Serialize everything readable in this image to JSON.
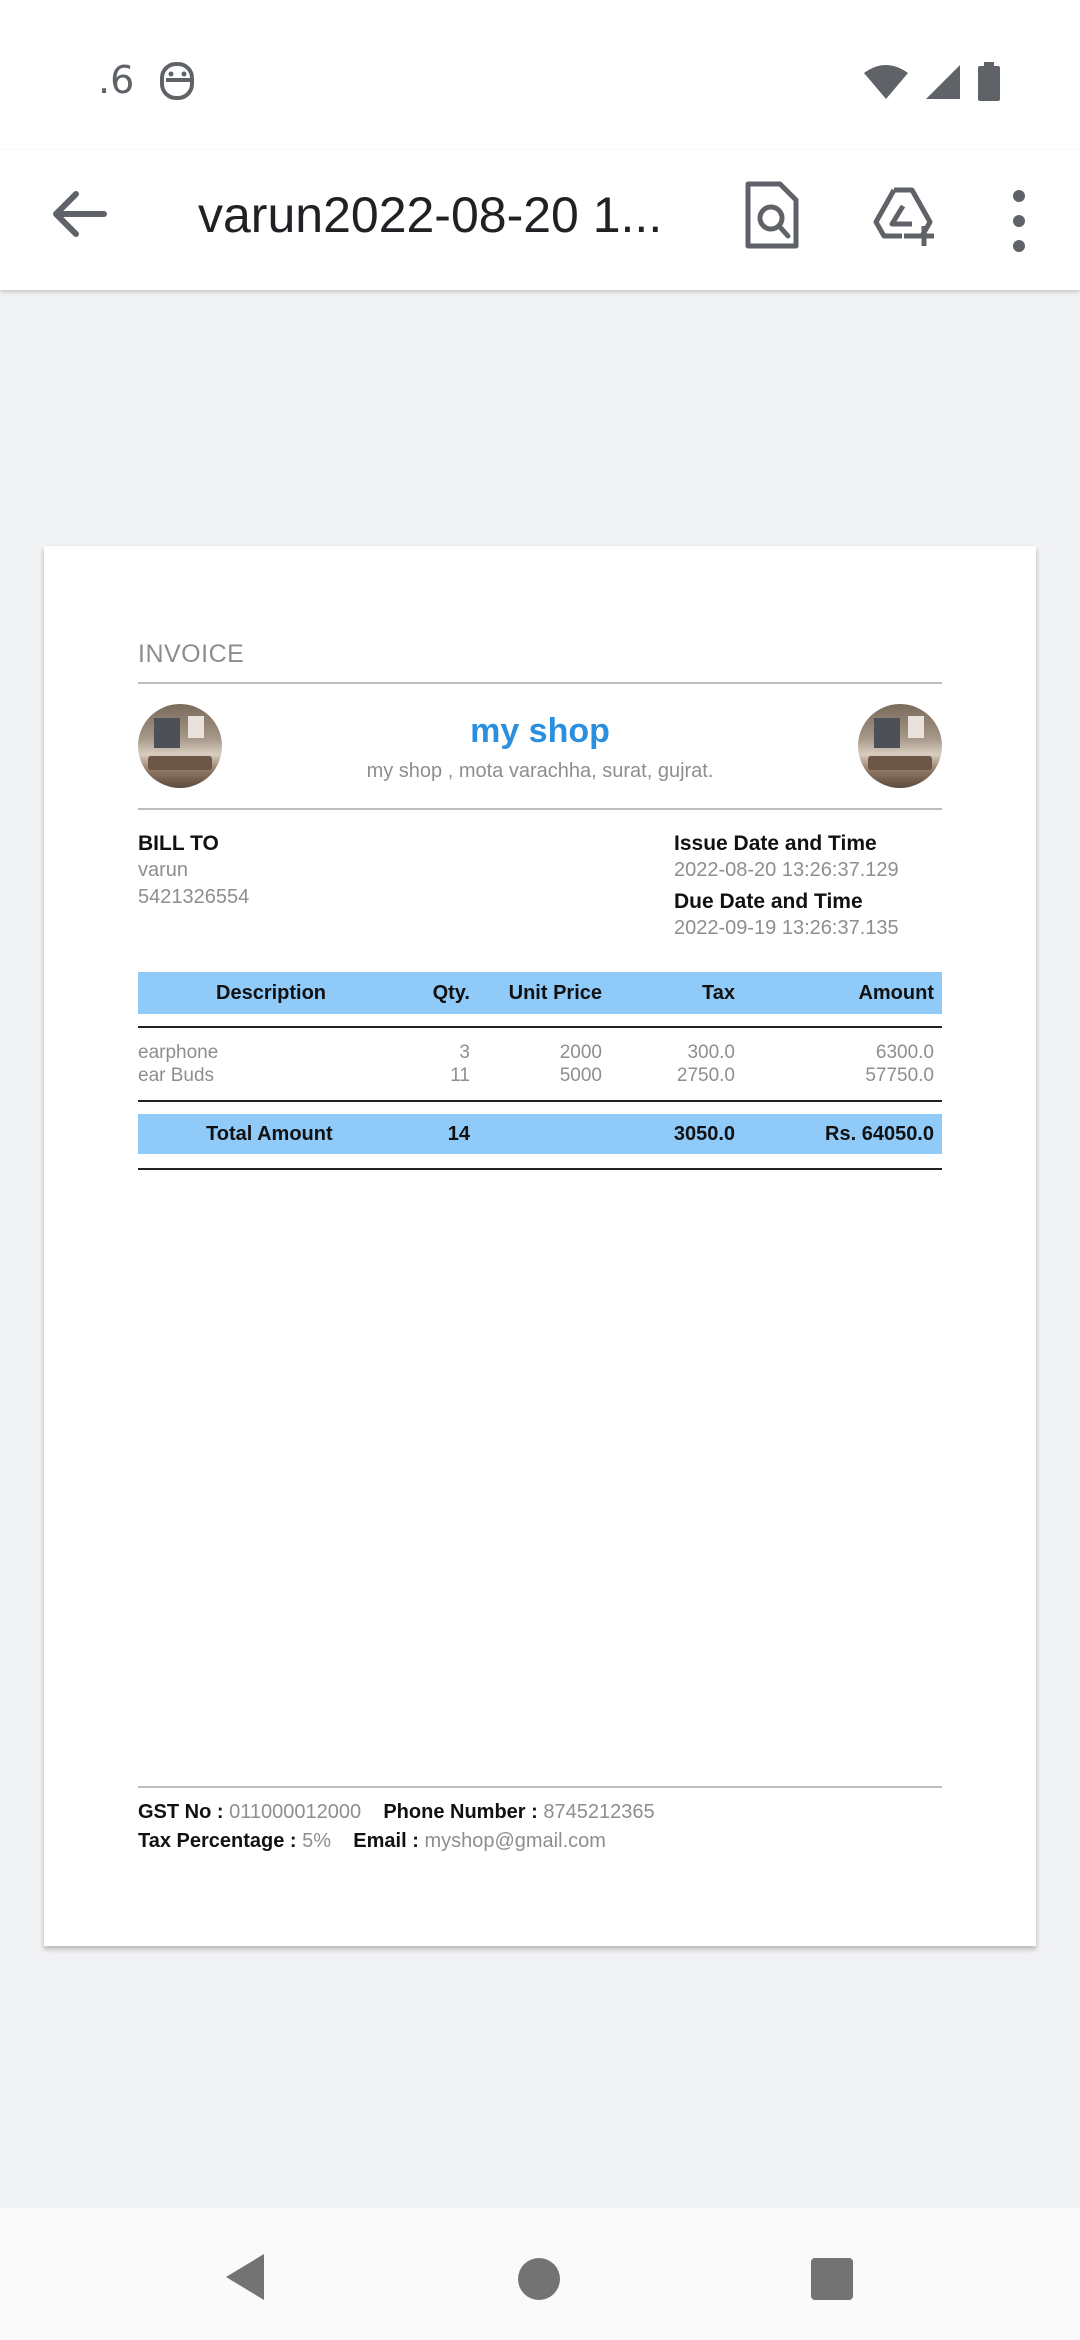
{
  "status_bar": {
    "time": ".6"
  },
  "app_bar": {
    "title": "varun2022-08-20 1..."
  },
  "invoice": {
    "heading": "INVOICE",
    "shop_name": "my shop",
    "shop_address": "my shop , mota varachha, surat, gujrat.",
    "bill_to_label": "BILL TO",
    "customer_name": "varun",
    "customer_phone": "5421326554",
    "issue_label": "Issue Date and Time",
    "issue_value": "2022-08-20 13:26:37.129",
    "due_label": "Due Date and Time",
    "due_value": "2022-09-19 13:26:37.135",
    "columns": [
      "Description",
      "Qty.",
      "Unit Price",
      "Tax",
      "Amount"
    ],
    "rows": [
      {
        "description": "earphone",
        "qty": "3",
        "unit_price": "2000",
        "tax": "300.0",
        "amount": "6300.0"
      },
      {
        "description": "ear Buds",
        "qty": "11",
        "unit_price": "5000",
        "tax": "2750.0",
        "amount": "57750.0"
      }
    ],
    "total": {
      "label": "Total Amount",
      "qty": "14",
      "tax": "3050.0",
      "amount": "Rs. 64050.0"
    },
    "footer": {
      "gst_label": "GST No :",
      "gst_value": "011000012000",
      "phone_label": "Phone Number :",
      "phone_value": "8745212365",
      "tax_label": "Tax Percentage :",
      "tax_value": "5%",
      "email_label": "Email :",
      "email_value": "myshop@gmail.com"
    }
  },
  "colors": {
    "accent": "#2b8fe0",
    "table_header": "#90caf9"
  }
}
